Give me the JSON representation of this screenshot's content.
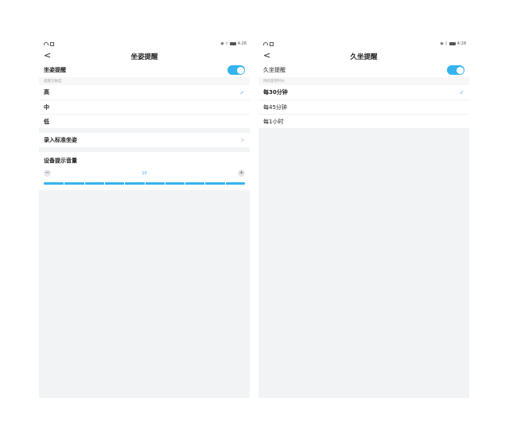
{
  "left_screen": {
    "status": {
      "time": "4:26"
    },
    "nav": {
      "back": "<",
      "title": "坐姿提醒"
    },
    "toggle_row": {
      "label": "坐姿提醒",
      "on": true
    },
    "sensitivity": {
      "caption": "提醒灵敏度",
      "options": [
        {
          "label": "高",
          "selected": true
        },
        {
          "label": "中",
          "selected": false
        },
        {
          "label": "低",
          "selected": false
        }
      ]
    },
    "calibrate": {
      "label": "录入标准坐姿",
      "chevron": ">"
    },
    "volume": {
      "title": "设备提示音量",
      "minus": "−",
      "plus": "+",
      "value": "10",
      "level_fraction": 1.0,
      "segments": 10
    }
  },
  "right_screen": {
    "status": {
      "time": "4:28"
    },
    "nav": {
      "back": "<",
      "title": "久坐提醒"
    },
    "toggle_row": {
      "label": "久坐提醒",
      "on": true
    },
    "duration": {
      "caption": "持续使用时长",
      "options": [
        {
          "label": "每30分钟",
          "selected": true
        },
        {
          "label": "每45分钟",
          "selected": false
        },
        {
          "label": "每1小时",
          "selected": false
        }
      ]
    }
  },
  "colors": {
    "accent": "#35b4ef",
    "check": "#5cb7ef",
    "background": "#f2f3f5"
  },
  "icons": {
    "back": "chevron-left-icon",
    "check": "check-icon",
    "chevron": "chevron-right-icon",
    "toggle": "toggle-switch-icon"
  }
}
